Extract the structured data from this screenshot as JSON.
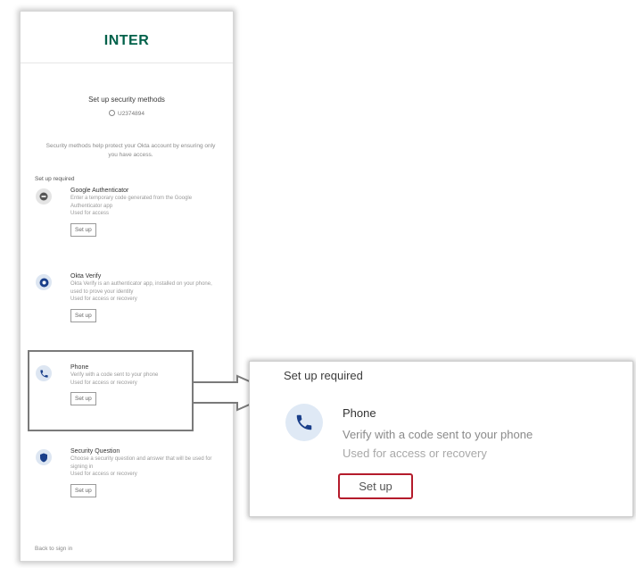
{
  "brand": {
    "logo_text": "INTER",
    "logo_color": "#00614a"
  },
  "page": {
    "title": "Set up security methods",
    "username": "U2374894",
    "intro": "Security methods help protect your Okta account by ensuring only you have access.",
    "required_label": "Set up required",
    "back_link": "Back to sign in"
  },
  "methods": [
    {
      "name": "Google Authenticator",
      "description": "Enter a temporary code generated from the Google Authenticator app",
      "usage": "Used for access",
      "button": "Set up",
      "icon": "google-authenticator-icon"
    },
    {
      "name": "Okta Verify",
      "description": "Okta Verify is an authenticator app, installed on your phone, used to prove your identity",
      "usage": "Used for access or recovery",
      "button": "Set up",
      "icon": "okta-verify-icon"
    },
    {
      "name": "Phone",
      "description": "Verify with a code sent to your phone",
      "usage": "Used for access or recovery",
      "button": "Set up",
      "icon": "phone-icon"
    },
    {
      "name": "Security Question",
      "description": "Choose a security question and answer that will be used for signing in",
      "usage": "Used for access or recovery",
      "button": "Set up",
      "icon": "security-question-icon"
    }
  ],
  "zoom": {
    "required_label": "Set up required",
    "name": "Phone",
    "description": "Verify with a code sent to your phone",
    "usage": "Used for access or recovery",
    "button": "Set up",
    "highlight_color": "#b41b2b"
  }
}
